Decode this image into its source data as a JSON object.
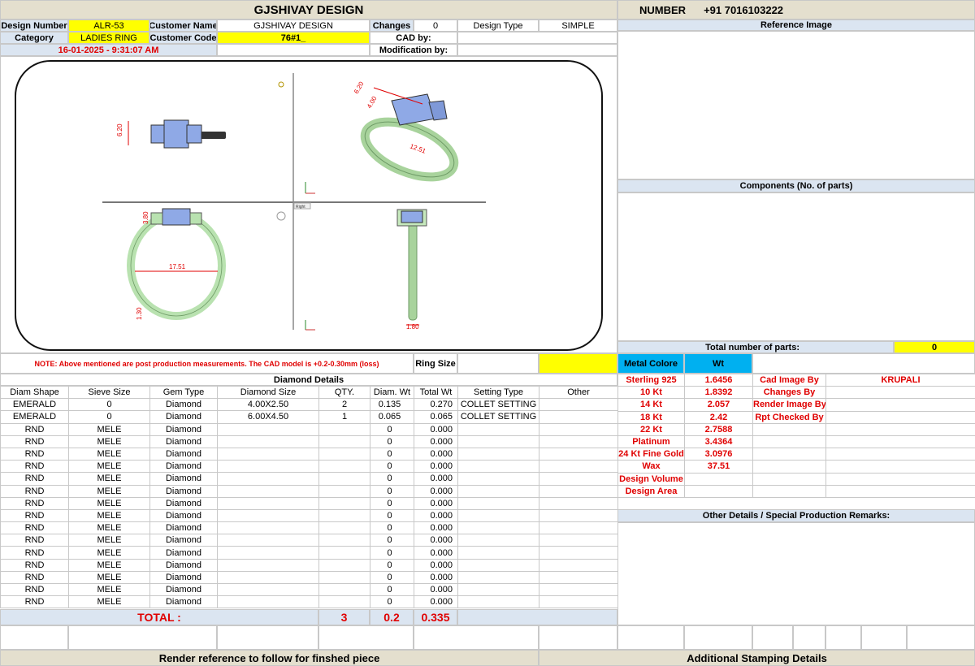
{
  "header": {
    "title": "GJSHIVAY DESIGN",
    "number_label": "NUMBER",
    "number_value": "+91 7016103222"
  },
  "info": {
    "design_number_label": "Design Number",
    "design_number": "ALR-53",
    "customer_name_label": "Customer Name",
    "customer_name": "GJSHIVAY DESIGN",
    "changes_label": "Changes",
    "changes": "0",
    "design_type_label": "Design Type",
    "design_type": "SIMPLE",
    "category_label": "Category",
    "category": "LADIES RING",
    "customer_code_label": "Customer Code",
    "customer_code": "76#1_",
    "cad_by_label": "CAD by:",
    "cad_by": "",
    "timestamp": "16-01-2025 - 9:31:07 AM",
    "modification_label": "Modification by:",
    "modification": ""
  },
  "right_panel": {
    "reference_image_label": "Reference Image",
    "components_label": "Components (No. of parts)",
    "total_parts_label": "Total number of parts:",
    "total_parts": "0",
    "other_details_label": "Other Details / Special Production Remarks:"
  },
  "cad": {
    "dimensions": [
      "6.20",
      "6.20",
      "4.00",
      "12.51",
      "3.80",
      "17.51",
      "1.30",
      "1.80"
    ],
    "view_label": "Right"
  },
  "note": "NOTE: Above mentioned are post production measurements. The CAD model is +0.2-0.30mm (loss)",
  "ring_size_label": "Ring Size",
  "ring_size": "",
  "diamond": {
    "section_title": "Diamond Details",
    "columns": [
      "Diam Shape",
      "Sieve Size",
      "Gem Type",
      "Diamond Size",
      "QTY.",
      "Diam. Wt",
      "Total Wt",
      "Setting Type",
      "Other"
    ],
    "rows": [
      [
        "EMERALD",
        "0",
        "Diamond",
        "4.00X2.50",
        "2",
        "0.135",
        "0.270",
        "COLLET SETTING",
        ""
      ],
      [
        "EMERALD",
        "0",
        "Diamond",
        "6.00X4.50",
        "1",
        "0.065",
        "0.065",
        "COLLET SETTING",
        ""
      ],
      [
        "RND",
        "MELE",
        "Diamond",
        "",
        "",
        "0",
        "0.000",
        "",
        ""
      ],
      [
        "RND",
        "MELE",
        "Diamond",
        "",
        "",
        "0",
        "0.000",
        "",
        ""
      ],
      [
        "RND",
        "MELE",
        "Diamond",
        "",
        "",
        "0",
        "0.000",
        "",
        ""
      ],
      [
        "RND",
        "MELE",
        "Diamond",
        "",
        "",
        "0",
        "0.000",
        "",
        ""
      ],
      [
        "RND",
        "MELE",
        "Diamond",
        "",
        "",
        "0",
        "0.000",
        "",
        ""
      ],
      [
        "RND",
        "MELE",
        "Diamond",
        "",
        "",
        "0",
        "0.000",
        "",
        ""
      ],
      [
        "RND",
        "MELE",
        "Diamond",
        "",
        "",
        "0",
        "0.000",
        "",
        ""
      ],
      [
        "RND",
        "MELE",
        "Diamond",
        "",
        "",
        "0",
        "0.000",
        "",
        ""
      ],
      [
        "RND",
        "MELE",
        "Diamond",
        "",
        "",
        "0",
        "0.000",
        "",
        ""
      ],
      [
        "RND",
        "MELE",
        "Diamond",
        "",
        "",
        "0",
        "0.000",
        "",
        ""
      ],
      [
        "RND",
        "MELE",
        "Diamond",
        "",
        "",
        "0",
        "0.000",
        "",
        ""
      ],
      [
        "RND",
        "MELE",
        "Diamond",
        "",
        "",
        "0",
        "0.000",
        "",
        ""
      ],
      [
        "RND",
        "MELE",
        "Diamond",
        "",
        "",
        "0",
        "0.000",
        "",
        ""
      ],
      [
        "RND",
        "MELE",
        "Diamond",
        "",
        "",
        "0",
        "0.000",
        "",
        ""
      ],
      [
        "RND",
        "MELE",
        "Diamond",
        "",
        "",
        "0",
        "0.000",
        "",
        ""
      ]
    ],
    "total_label": "TOTAL :",
    "total_qty": "3",
    "total_diam_wt": "0.2",
    "total_wt": "0.335"
  },
  "metal": {
    "color_label": "Metal Colore",
    "wt_label": "Wt",
    "rows": [
      [
        "Sterling 925",
        "1.6456"
      ],
      [
        "10 Kt",
        "1.8392"
      ],
      [
        "14 Kt",
        "2.057"
      ],
      [
        "18 Kt",
        "2.42"
      ],
      [
        "22 Kt",
        "2.7588"
      ],
      [
        "Platinum",
        "3.4364"
      ],
      [
        "24 Kt Fine Gold",
        "3.0976"
      ],
      [
        "Wax",
        "37.51"
      ],
      [
        "Design Volume",
        ""
      ],
      [
        "Design Area",
        ""
      ]
    ],
    "side": [
      [
        "Cad Image By",
        "KRUPALI"
      ],
      [
        "Changes By",
        ""
      ],
      [
        "Render Image By",
        ""
      ],
      [
        "Rpt Checked By",
        ""
      ]
    ]
  },
  "footer": {
    "render_note": "Render reference to follow for finshed piece",
    "stamping": "Additional Stamping Details"
  },
  "colors": {
    "yellow": "#ffff00",
    "header_beige": "#e4dfce",
    "light_blue": "#dbe5f1",
    "metal_blue": "#00b0f0",
    "red": "#e00000",
    "ring_green": "#b9e2b0",
    "stone_blue": "#8fa9e6"
  }
}
